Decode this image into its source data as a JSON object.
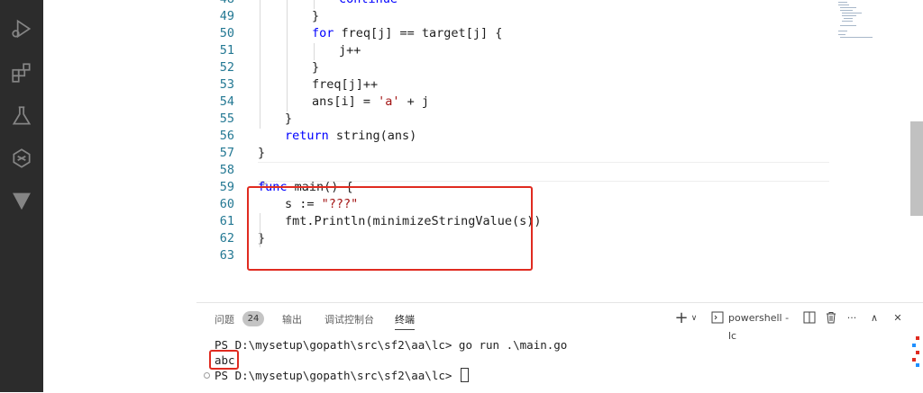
{
  "editor": {
    "lines": [
      {
        "num": "48",
        "indent": 3,
        "tokens": [
          {
            "t": "continue",
            "c": "kw"
          }
        ]
      },
      {
        "num": "49",
        "indent": 2,
        "tokens": [
          {
            "t": "}",
            "c": ""
          }
        ]
      },
      {
        "num": "50",
        "indent": 2,
        "tokens": [
          {
            "t": "for",
            "c": "kw"
          },
          {
            "t": " freq[j] == target[j] {",
            "c": ""
          }
        ]
      },
      {
        "num": "51",
        "indent": 3,
        "tokens": [
          {
            "t": "j++",
            "c": ""
          }
        ]
      },
      {
        "num": "52",
        "indent": 2,
        "tokens": [
          {
            "t": "}",
            "c": ""
          }
        ]
      },
      {
        "num": "53",
        "indent": 2,
        "tokens": [
          {
            "t": "freq[j]++",
            "c": ""
          }
        ]
      },
      {
        "num": "54",
        "indent": 2,
        "tokens": [
          {
            "t": "ans[i] = ",
            "c": ""
          },
          {
            "t": "'a'",
            "c": "str"
          },
          {
            "t": " + j",
            "c": ""
          }
        ]
      },
      {
        "num": "55",
        "indent": 1,
        "tokens": [
          {
            "t": "}",
            "c": ""
          }
        ]
      },
      {
        "num": "56",
        "indent": 1,
        "tokens": [
          {
            "t": "return",
            "c": "kw"
          },
          {
            "t": " string(ans)",
            "c": ""
          }
        ]
      },
      {
        "num": "57",
        "indent": 0,
        "tokens": [
          {
            "t": "}",
            "c": ""
          }
        ]
      },
      {
        "num": "58",
        "indent": 0,
        "tokens": []
      },
      {
        "num": "59",
        "indent": 0,
        "tokens": [
          {
            "t": "func",
            "c": "kw"
          },
          {
            "t": " main() {",
            "c": ""
          }
        ]
      },
      {
        "num": "60",
        "indent": 1,
        "tokens": [
          {
            "t": "s := ",
            "c": ""
          },
          {
            "t": "\"???\"",
            "c": "str"
          }
        ]
      },
      {
        "num": "61",
        "indent": 1,
        "tokens": [
          {
            "t": "fmt.Println(minimizeStringValue(s))",
            "c": ""
          }
        ]
      },
      {
        "num": "62",
        "indent": 0,
        "tokens": [
          {
            "t": "}",
            "c": ""
          }
        ]
      },
      {
        "num": "63",
        "indent": 0,
        "tokens": []
      }
    ]
  },
  "panel": {
    "tabs": [
      {
        "label": "问题",
        "active": false
      },
      {
        "label": "输出",
        "active": false
      },
      {
        "label": "调试控制台",
        "active": false
      },
      {
        "label": "终端",
        "active": true
      }
    ],
    "problems_count": "24",
    "terminal_name": "powershell - lc",
    "add_icon": "+",
    "chevron_icon": "∨",
    "split_icon": "split-icon",
    "trash_icon": "trash-icon",
    "more_icon": "···",
    "maximize_icon": "∧",
    "close_icon": "✕"
  },
  "terminal": {
    "line1": "PS D:\\mysetup\\gopath\\src\\sf2\\aa\\lc> go run .\\main.go",
    "output": "abc",
    "line3": "PS D:\\mysetup\\gopath\\src\\sf2\\aa\\lc> "
  },
  "colors": {
    "activity_bar": "#2c2c2c",
    "highlight": "#e02b20",
    "keyword": "#0000ff",
    "string": "#a31515",
    "line_number": "#237893"
  }
}
